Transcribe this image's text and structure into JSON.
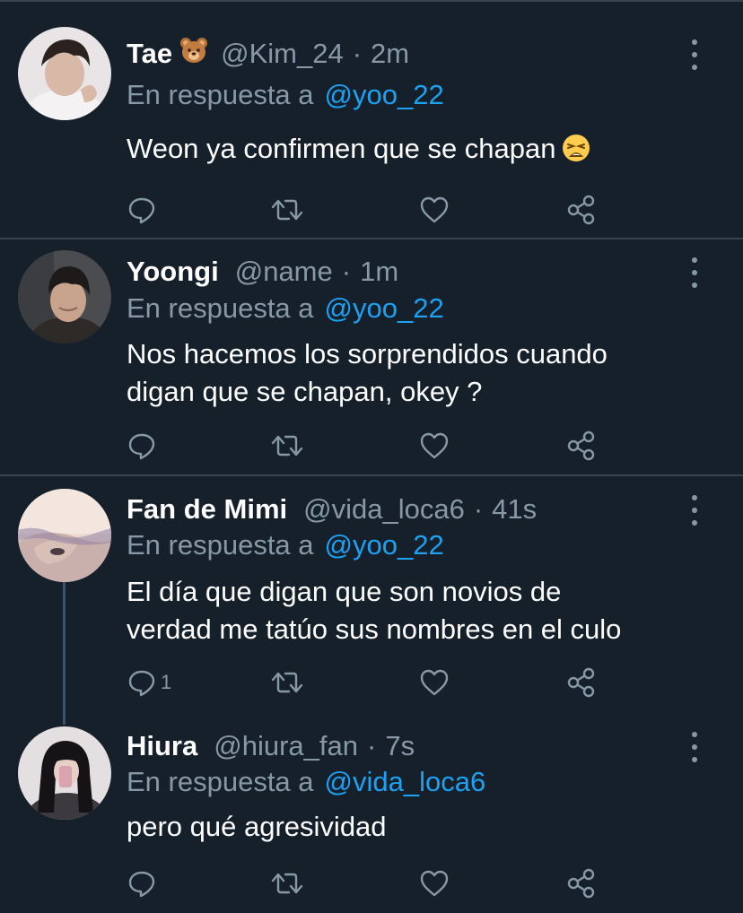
{
  "colors": {
    "background": "#15202b",
    "divider": "#38444d",
    "primary_text": "#ffffff",
    "secondary_text": "#8899a6",
    "accent": "#1da1f2",
    "thread_line": "#3d5466"
  },
  "labels": {
    "in_reply_to": "En respuesta a"
  },
  "tweets": [
    {
      "name": "Tae",
      "name_emoji": "bear-face-emoji",
      "handle": "@Kim_24",
      "separator": "·",
      "time": "2m",
      "reply_to": "@yoo_22",
      "text_line1": "Weon ya confirmen que se chapan",
      "text_emoji": "weary-face-emoji",
      "reply_count": ""
    },
    {
      "name": "Yoongi",
      "handle": "@name",
      "separator": "·",
      "time": "1m",
      "reply_to": "@yoo_22",
      "text_line1": "Nos hacemos los sorprendidos cuando",
      "text_line2": "digan que se chapan, okey ?",
      "reply_count": ""
    },
    {
      "name": "Fan de Mimi",
      "handle": "@vida_loca6",
      "separator": "·",
      "time": "41s",
      "reply_to": "@yoo_22",
      "text_line1": "El día que digan que son novios de",
      "text_line2": "verdad me tatúo sus nombres en el culo",
      "reply_count": "1"
    },
    {
      "name": "Hiura",
      "handle": "@hiura_fan",
      "separator": "·",
      "time": "7s",
      "reply_to": "@vida_loca6",
      "text_line1": "pero qué agresividad",
      "reply_count": ""
    }
  ],
  "icons": {
    "reply": "reply-icon",
    "retweet": "retweet-icon",
    "like": "heart-icon",
    "share": "share-icon",
    "more": "more-options-icon"
  }
}
